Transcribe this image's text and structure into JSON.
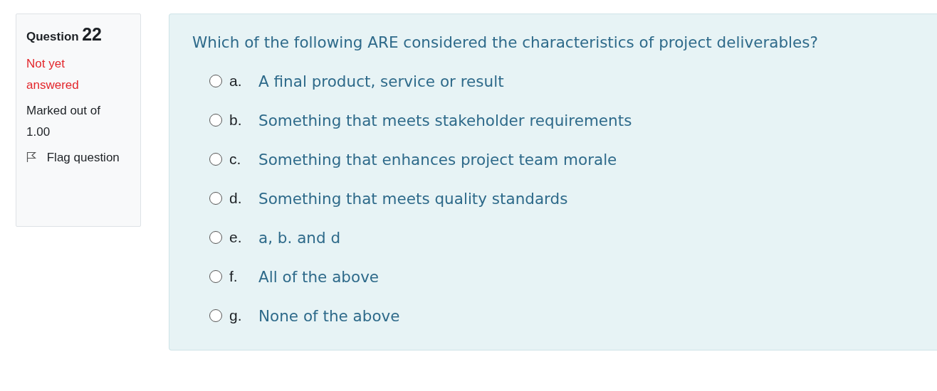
{
  "info": {
    "label": "Question",
    "number": "22",
    "state": "Not yet answered",
    "marks": "Marked out of 1.00",
    "flag": {
      "label": "Flag question",
      "flagged": false
    }
  },
  "question": {
    "text": "Which of the following ARE considered the characteristics of project deliverables?",
    "options": [
      {
        "letter": "a.",
        "text": "A final product, service or result",
        "selected": false
      },
      {
        "letter": "b.",
        "text": "Something that meets stakeholder requirements",
        "selected": false
      },
      {
        "letter": "c.",
        "text": "Something that enhances project team morale",
        "selected": false
      },
      {
        "letter": "d.",
        "text": "Something that meets quality standards",
        "selected": false
      },
      {
        "letter": "e.",
        "text": "a, b. and d",
        "selected": false
      },
      {
        "letter": "f.",
        "text": "All of the above",
        "selected": false
      },
      {
        "letter": "g.",
        "text": "None of the above",
        "selected": false
      }
    ]
  }
}
